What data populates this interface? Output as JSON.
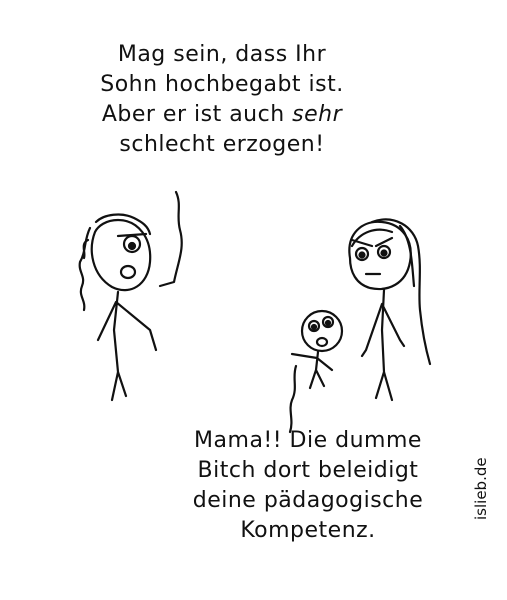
{
  "speech_top": {
    "line1": "Mag sein, dass Ihr",
    "line2": "Sohn hochbegabt ist.",
    "line3_prefix": "Aber er ist auch ",
    "line3_emphasis": "sehr",
    "line4": "schlecht erzogen!"
  },
  "speech_bottom": {
    "line1": "Mama!! Die dumme",
    "line2": "Bitch dort beleidigt",
    "line3": "deine pädagogische",
    "line4": "Kompetenz."
  },
  "signature": "islieb.de"
}
